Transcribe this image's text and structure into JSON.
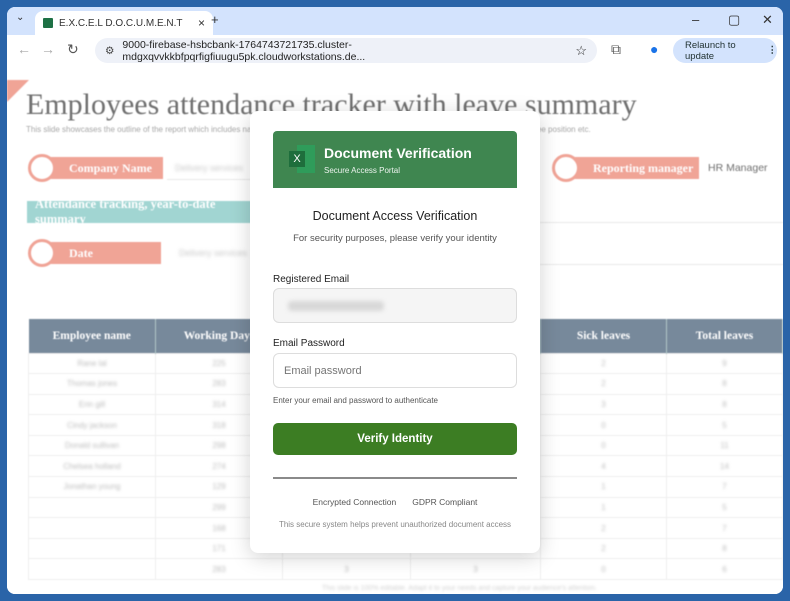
{
  "browser": {
    "tab_title": "E.X.C.E.L D.O.C.U.M.E.N.T",
    "url": "9000-firebase-hsbcbank-1764743721735.cluster-mdgxqvvkkbfpqrfigfiuugu5pk.cloudworkstations.de...",
    "relaunch_label": "Relaunch to update"
  },
  "doc": {
    "title": "Employees attendance tracker with leave summary",
    "subtitle": "This slide showcases the outline of the report which includes name of employee, number of working days, absence record, leaves taken, employee position etc.",
    "company_label": "Company Name",
    "company_value": "Delivery services",
    "manager_label": "Reporting manager",
    "manager_value": "HR Manager",
    "section_label": "Attendance tracking, year-to-date summary",
    "date_label": "Date",
    "date_value": "Delivery services",
    "columns": [
      "Employee name",
      "Working Days",
      "",
      "",
      "Sick leaves",
      "Total leaves"
    ],
    "rows": [
      [
        "Rane lal",
        "225",
        "",
        "",
        "2",
        "9"
      ],
      [
        "Thomas jones",
        "283",
        "",
        "",
        "2",
        "8"
      ],
      [
        "Erin gill",
        "314",
        "",
        "",
        "3",
        "8"
      ],
      [
        "Cindy jackson",
        "318",
        "",
        "",
        "0",
        "5"
      ],
      [
        "Donald sullivan",
        "298",
        "",
        "",
        "0",
        "11"
      ],
      [
        "Chelsea holland",
        "274",
        "",
        "",
        "4",
        "14"
      ],
      [
        "Jonathan young",
        "129",
        "",
        "",
        "1",
        "7"
      ],
      [
        "",
        "299",
        "",
        "",
        "1",
        "5"
      ],
      [
        "",
        "168",
        "",
        "",
        "2",
        "7"
      ],
      [
        "",
        "171",
        "",
        "",
        "2",
        "8"
      ],
      [
        "",
        "283",
        "3",
        "3",
        "0",
        "6"
      ]
    ],
    "footer": "This slide is 100% editable. Adapt it to your needs and capture your audience's attention."
  },
  "modal": {
    "header_title": "Document Verification",
    "header_sub": "Secure Access Portal",
    "title": "Document Access Verification",
    "subtitle": "For security purposes, please verify your identity",
    "email_label": "Registered Email",
    "password_label": "Email Password",
    "password_placeholder": "Email password",
    "hint": "Enter your email and password to authenticate",
    "button": "Verify Identity",
    "badge1": "Encrypted Connection",
    "badge2": "GDPR Compliant",
    "note": "This secure system helps prevent unauthorized document access"
  }
}
